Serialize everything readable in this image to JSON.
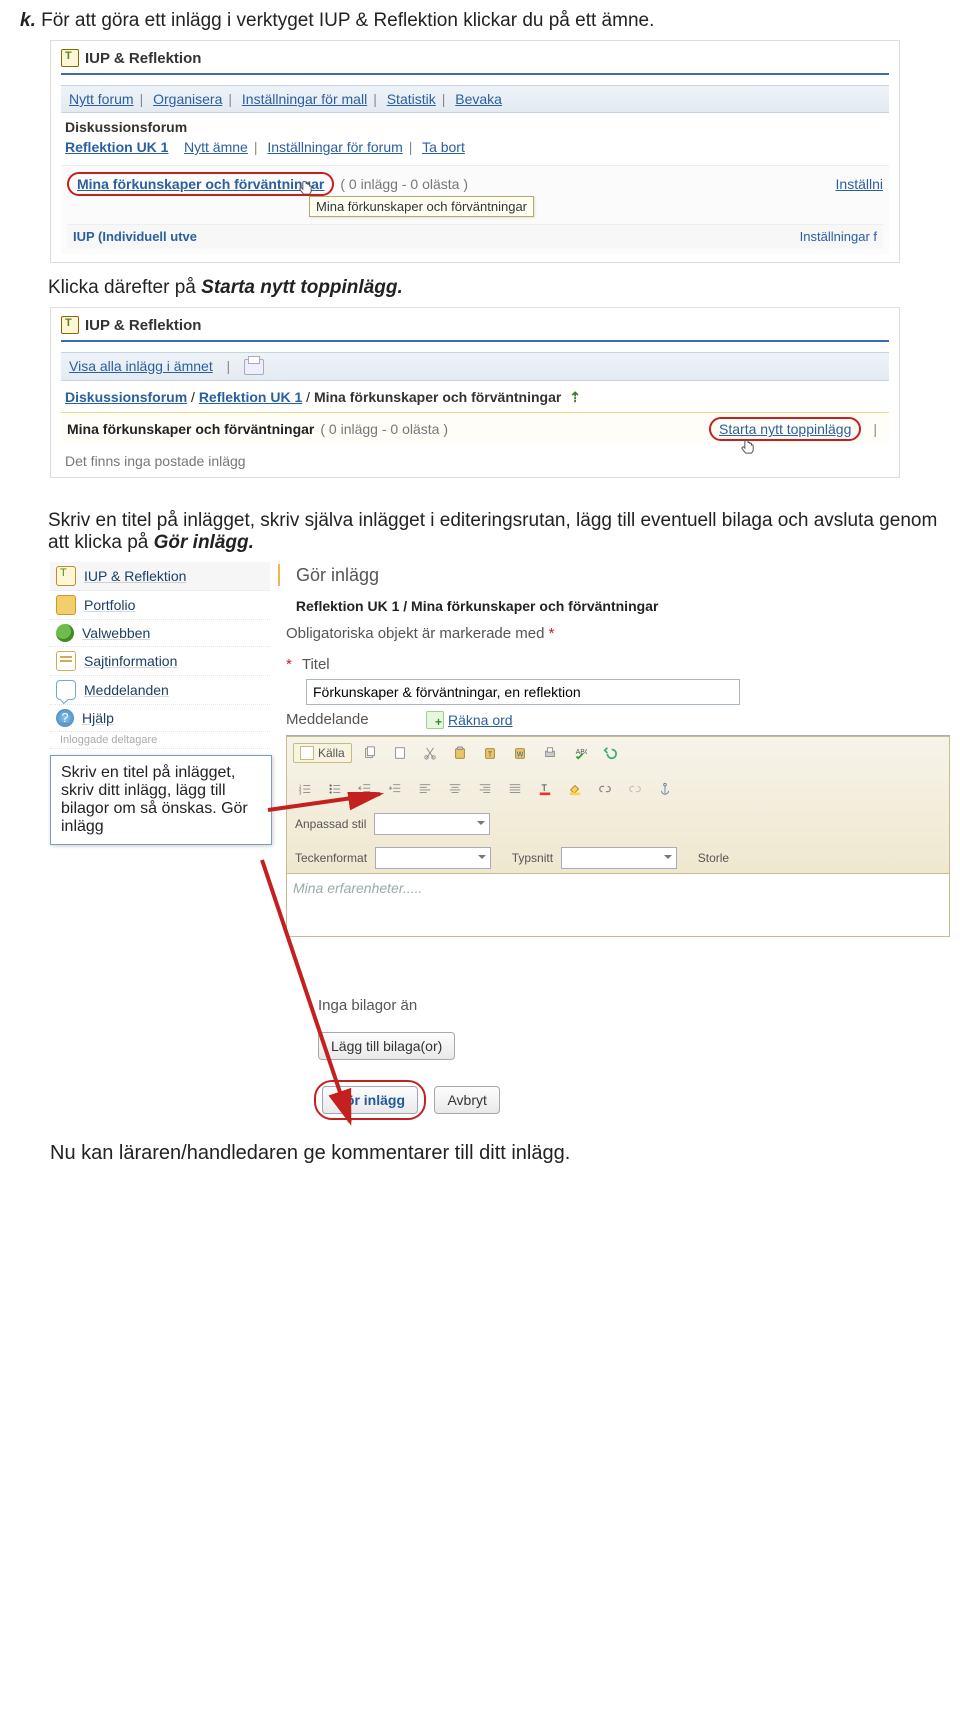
{
  "intro": {
    "prefix": "k.",
    "text": " För att göra ett inlägg i verktyget IUP & Reflektion klickar du på ett ämne."
  },
  "shot1": {
    "title": "IUP & Reflektion",
    "menu": [
      "Nytt forum",
      "Organisera",
      "Inställningar för mall",
      "Statistik",
      "Bevaka"
    ],
    "section": "Diskussionsforum",
    "forum_name": "Reflektion UK 1",
    "forum_links": [
      "Nytt ämne",
      "Inställningar för forum",
      "Ta bort"
    ],
    "topic_link": "Mina förkunskaper och förväntningar",
    "topic_meta": "( 0 inlägg - 0 olästa )",
    "right_cut": "Inställni",
    "tooltip": "Mina förkunskaper och förväntningar",
    "cutoff_left": "IUP (Individuell utve",
    "cutoff_right": "Inställningar f"
  },
  "plain1": {
    "pre": "Klicka därefter på ",
    "bold": "Starta nytt toppinlägg.",
    "post": ""
  },
  "shot2": {
    "title": "IUP & Reflektion",
    "top_link": "Visa alla inlägg i ämnet",
    "bc_forum": "Diskussionsforum",
    "bc_sub": "Reflektion UK 1",
    "bc_current": "Mina förkunskaper och förväntningar",
    "row_title": "Mina förkunskaper och förväntningar",
    "row_meta": "( 0 inlägg - 0 olästa )",
    "start_link": "Starta nytt toppinlägg",
    "empty": "Det finns inga postade inlägg"
  },
  "plain2": "Skriv en titel på inlägget, skriv själva inlägget i editeringsrutan, lägg till eventuell bilaga och avsluta genom att klicka på ",
  "plain2_bold": "Gör inlägg.",
  "shot3": {
    "side": [
      "IUP & Reflektion",
      "Portfolio",
      "Valwebben",
      "Sajtinformation",
      "Meddelanden",
      "Hjälp"
    ],
    "side_small": "Inloggade deltagare",
    "callout": "Skriv en titel på inlägget, skriv ditt inlägg, lägg till bilagor om så önskas. Gör inlägg",
    "heading": "Gör inlägg",
    "path_pre": "Reflektion UK 1",
    "path_post": "Mina förkunskaper och förväntningar",
    "mandatory": "Obligatoriska objekt är markerade med ",
    "title_label": "Titel",
    "title_value": "Förkunskaper & förväntningar, en reflektion",
    "msg_label": "Meddelande",
    "rakna": "Räkna ord",
    "source_btn": "Källa",
    "styles": {
      "anpassad": "Anpassad stil",
      "tecken": "Teckenformat",
      "typsnitt": "Typsnitt",
      "storlek": "Storle"
    },
    "editor_placeholder": "Mina erfarenheter.....",
    "no_attach": "Inga bilagor än",
    "add_attach": "Lägg till bilaga(or)",
    "submit": "Gör inlägg",
    "cancel": "Avbryt"
  },
  "foot": "Nu kan läraren/handledaren ge kommentarer till ditt inlägg."
}
